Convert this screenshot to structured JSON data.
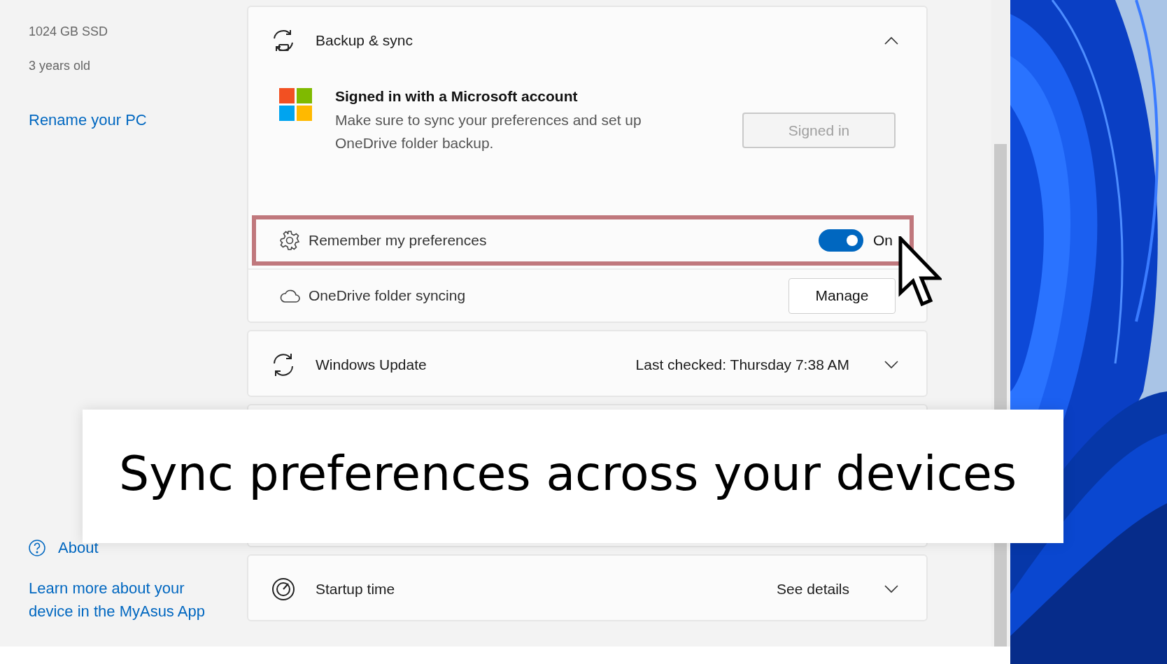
{
  "sidebar": {
    "specs": [
      "1024 GB SSD",
      "3 years old"
    ],
    "rename_link": "Rename your PC",
    "about_link": "About",
    "myasus_link": "Learn more about your device in the MyAsus App"
  },
  "cards": [
    {
      "kind": "backup",
      "title": "Backup & sync",
      "expanded": true,
      "account": {
        "title": "Signed in with a Microsoft account",
        "description": "Make sure to sync your preferences and set up OneDrive folder backup.",
        "button": "Signed in",
        "button_disabled": true
      },
      "settings": [
        {
          "kind": "toggle",
          "label": "Remember my preferences",
          "on": true,
          "state_text": "On",
          "highlighted": true
        },
        {
          "kind": "button",
          "label": "OneDrive folder syncing",
          "button": "Manage",
          "highlighted": false
        }
      ]
    },
    {
      "kind": "update",
      "title": "Windows Update",
      "status": "Last checked: Thursday 7:38 AM",
      "expanded": false
    },
    {
      "kind": "covered"
    },
    {
      "kind": "startup",
      "title": "Startup time",
      "status": "See details",
      "expanded": false
    }
  ],
  "caption": "Sync preferences across your devices"
}
